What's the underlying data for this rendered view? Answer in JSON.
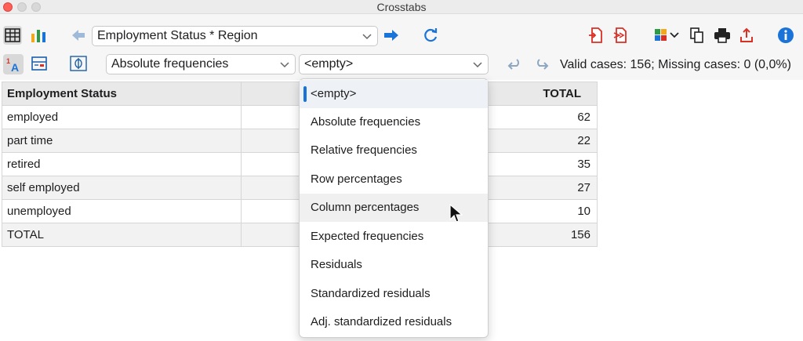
{
  "window": {
    "title": "Crosstabs"
  },
  "toolbar": {
    "table_selector": "Employment Status * Region",
    "display_mode": "Absolute frequencies",
    "second_mode": "<empty>",
    "status": "Valid cases: 156;  Missing cases: 0 (0,0%)",
    "icons": [
      "table-icon",
      "chart-icon",
      "back-arrow-icon",
      "forward-arrow-icon",
      "refresh-icon",
      "export-icon",
      "export-alt-icon",
      "color-palette-icon",
      "copy-icon",
      "print-icon",
      "share-icon",
      "info-icon",
      "label-toggle-icon",
      "layout-icon",
      "phi-icon",
      "undo-icon",
      "redo-icon"
    ]
  },
  "table": {
    "headers": [
      "Employment Status",
      "TOTAL"
    ],
    "rows": [
      {
        "label": "employed",
        "total": "62"
      },
      {
        "label": "part time",
        "total": "22"
      },
      {
        "label": "retired",
        "total": "35"
      },
      {
        "label": "self employed",
        "total": "27"
      },
      {
        "label": "unemployed",
        "total": "10"
      },
      {
        "label": "TOTAL",
        "total": "156"
      }
    ]
  },
  "dropdown": {
    "options": [
      "<empty>",
      "Absolute frequencies",
      "Relative frequencies",
      "Row percentages",
      "Column percentages",
      "Expected frequencies",
      "Residuals",
      "Standardized residuals",
      "Adj. standardized residuals"
    ],
    "selected": "<empty>",
    "hovered": "Column percentages"
  },
  "colors": {
    "accent": "#1a73d9",
    "export_red": "#d93025"
  }
}
